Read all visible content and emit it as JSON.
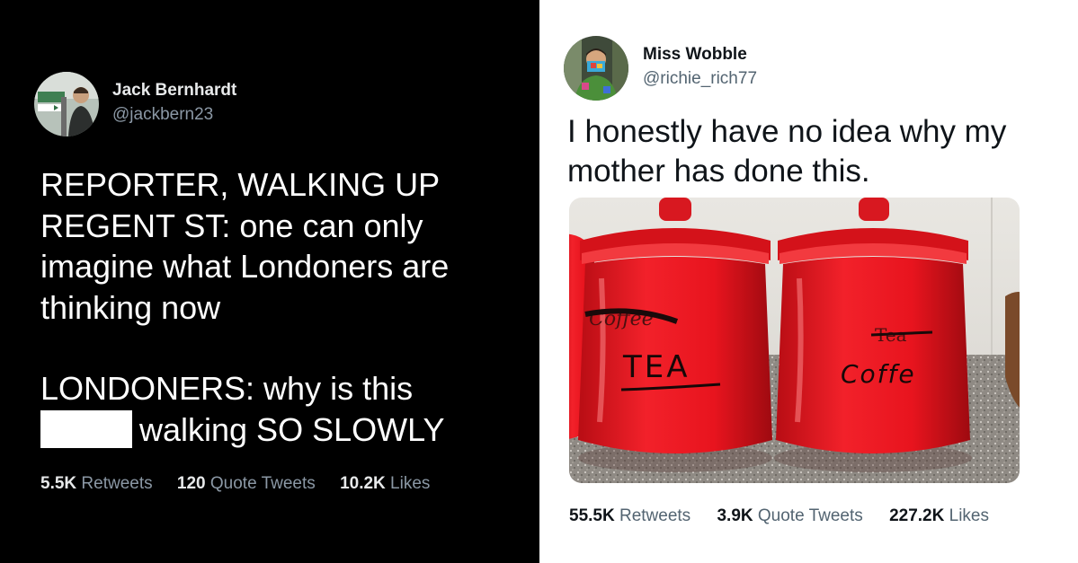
{
  "tweets": [
    {
      "theme": "dark",
      "user": {
        "name": "Jack Bernhardt",
        "handle": "@jackbern23"
      },
      "body": {
        "line1": "REPORTER, WALKING UP REGENT ST: one can only imagine what Londoners are thinking now",
        "line2_before": "LONDONERS: why is this",
        "line2_after": "walking SO SLOWLY"
      },
      "stats": {
        "retweets": {
          "value": "5.5K",
          "label": "Retweets"
        },
        "quotes": {
          "value": "120",
          "label": "Quote Tweets"
        },
        "likes": {
          "value": "10.2K",
          "label": "Likes"
        }
      }
    },
    {
      "theme": "light",
      "user": {
        "name": "Miss Wobble",
        "handle": "@richie_rich77"
      },
      "body": {
        "text": "I honestly have no idea why my mother has done this."
      },
      "photo": {
        "jar_left": {
          "crossed_label": "Coffee",
          "new_label": "TEA"
        },
        "jar_right": {
          "crossed_label": "Tea",
          "new_label": "Coffee"
        }
      },
      "stats": {
        "retweets": {
          "value": "55.5K",
          "label": "Retweets"
        },
        "quotes": {
          "value": "3.9K",
          "label": "Quote Tweets"
        },
        "likes": {
          "value": "227.2K",
          "label": "Likes"
        }
      }
    }
  ],
  "colors": {
    "dark_bg": "#000000",
    "jar_red": "#e8141e",
    "counter": "#8f8a84"
  }
}
